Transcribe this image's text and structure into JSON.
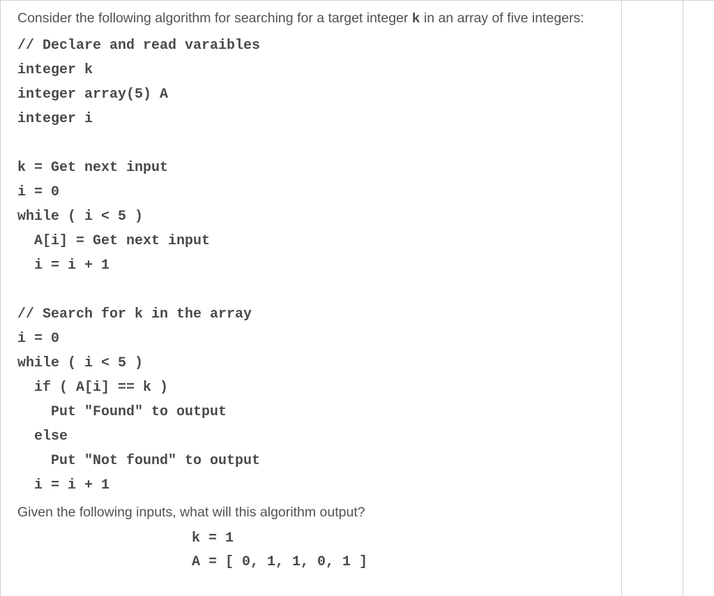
{
  "intro": {
    "part1": "Consider the following algorithm for searching for a target integer ",
    "code": "k",
    "part2": " in an array of five integers:"
  },
  "code": {
    "line1": "// Declare and read varaibles",
    "line2": "integer k",
    "line3": "integer array(5) A",
    "line4": "integer i",
    "line5": "",
    "line6": "k = Get next input",
    "line7": "i = 0",
    "line8": "while ( i < 5 )",
    "line9": "  A[i] = Get next input",
    "line10": "  i = i + 1",
    "line11": "",
    "line12": "// Search for k in the array",
    "line13": "i = 0",
    "line14": "while ( i < 5 )",
    "line15": "  if ( A[i] == k )",
    "line16": "    Put \"Found\" to output",
    "line17": "  else",
    "line18": "    Put \"Not found\" to output",
    "line19": "  i = i + 1"
  },
  "question": "Given the following inputs, what will this algorithm output?",
  "inputs": {
    "line1": "k = 1",
    "line2": "A = [ 0, 1, 1, 0, 1 ]"
  }
}
